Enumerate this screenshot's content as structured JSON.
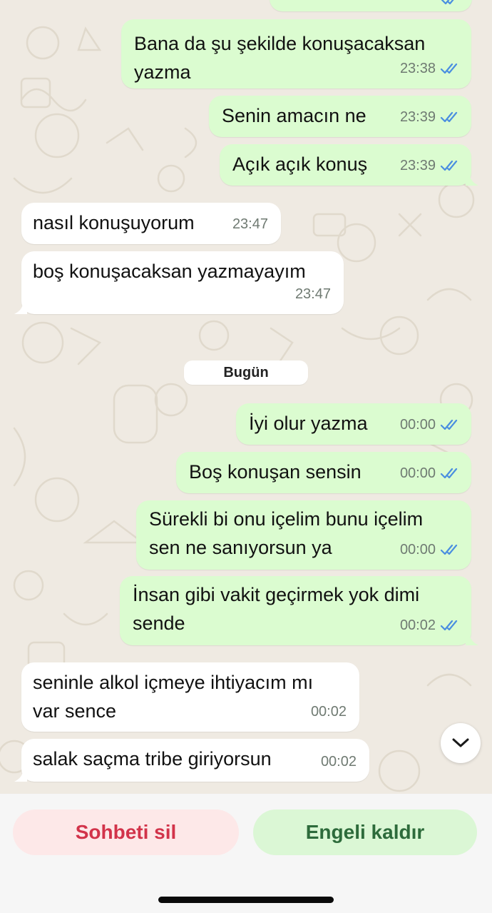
{
  "messages": [
    {
      "dir": "out",
      "lines": [
        "Bana da şu şekilde konuşacaksan",
        "yazma"
      ],
      "time": "23:38",
      "read": true
    },
    {
      "dir": "out",
      "lines": [
        "Senin amacın ne"
      ],
      "time": "23:39",
      "read": true
    },
    {
      "dir": "out",
      "lines": [
        "Açık açık konuş"
      ],
      "time": "23:39",
      "read": true
    },
    {
      "dir": "in",
      "lines": [
        "nasıl konuşuyorum"
      ],
      "time": "23:47"
    },
    {
      "dir": "in",
      "lines": [
        "boş konuşacaksan yazmayayım"
      ],
      "time": "23:47"
    },
    {
      "dir": "out",
      "lines": [
        "İyi olur yazma"
      ],
      "time": "00:00",
      "read": true
    },
    {
      "dir": "out",
      "lines": [
        "Boş konuşan sensin"
      ],
      "time": "00:00",
      "read": true
    },
    {
      "dir": "out",
      "lines": [
        "Sürekli bi onu içelim bunu içelim",
        "sen ne sanıyorsun ya"
      ],
      "time": "00:00",
      "read": true
    },
    {
      "dir": "out",
      "lines": [
        "İnsan gibi vakit geçirmek yok dimi",
        "sende"
      ],
      "time": "00:02",
      "read": true
    },
    {
      "dir": "in",
      "lines": [
        "seninle alkol içmeye ihtiyacım mı",
        "var sence"
      ],
      "time": "00:02"
    },
    {
      "dir": "in",
      "lines": [
        "salak saçma tribe giriyorsun"
      ],
      "time": "00:02"
    }
  ],
  "date_divider": "Bugün",
  "scroll_down_icon": "chevron-down-icon",
  "actions": {
    "delete_chat": "Sohbeti sil",
    "unblock": "Engeli kaldır"
  },
  "colors": {
    "outgoing_bubble": "#dbfcd0",
    "incoming_bubble": "#ffffff",
    "read_ticks": "#4a8ee0",
    "delete_text": "#d2334a",
    "unblock_text": "#2d6b3b"
  }
}
